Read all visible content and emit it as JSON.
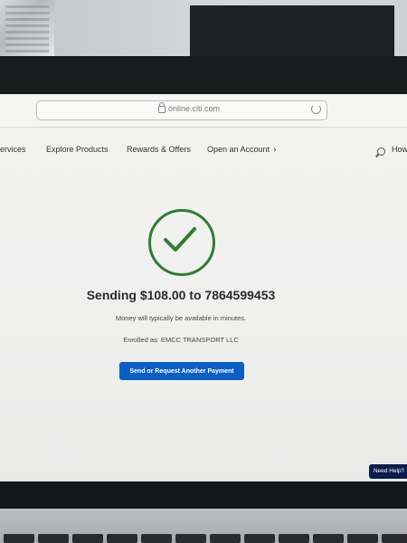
{
  "browser": {
    "url": "online.citi.com"
  },
  "nav": {
    "items": [
      "Services",
      "Explore Products",
      "Rewards & Offers",
      "Open an Account"
    ],
    "search_label": "How"
  },
  "confirmation": {
    "headline": "Sending $108.00 to 7864599453",
    "subtext": "Money will typically be available in minutes.",
    "enrolled": "Enrolled as: EMCC TRANSPORT LLC",
    "primary_button": "Send or Request Another Payment"
  },
  "help": {
    "label": "Need Help?"
  },
  "colors": {
    "success_green": "#2f7d32",
    "primary_blue": "#0a5fc4",
    "help_navy": "#0c1b4d"
  },
  "icons": [
    "lock-icon",
    "reload-icon",
    "chevron-right-icon",
    "search-icon",
    "checkmark-icon"
  ]
}
